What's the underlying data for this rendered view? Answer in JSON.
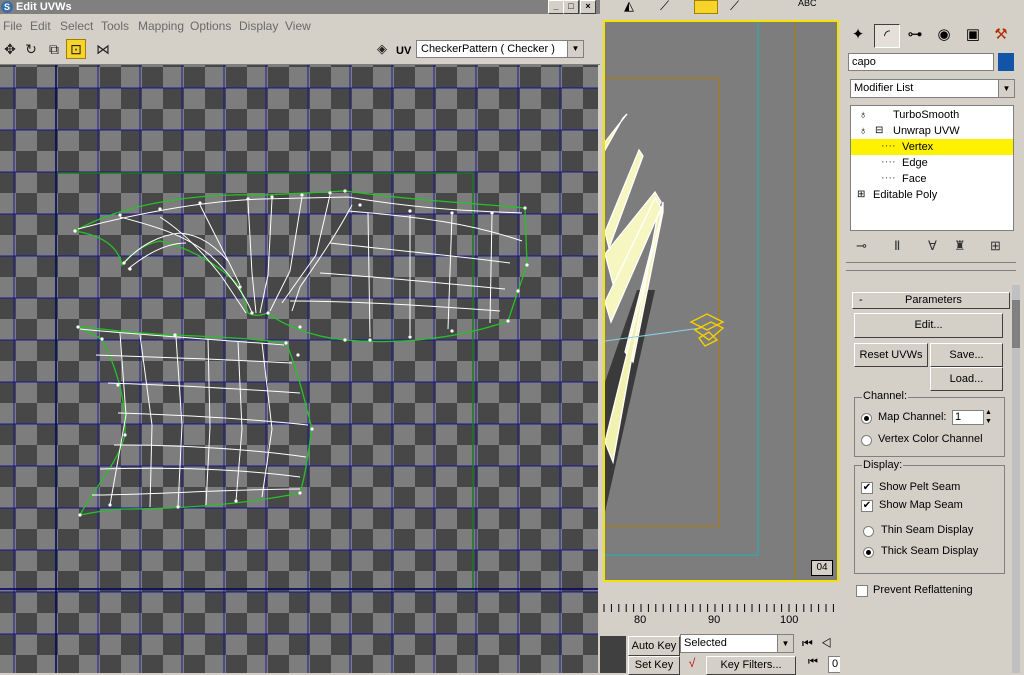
{
  "uvw_window": {
    "title": "Edit UVWs",
    "menu": [
      "File",
      "Edit",
      "Select",
      "Tools",
      "Mapping",
      "Options",
      "Display",
      "View"
    ],
    "toolbar": {
      "tools": [
        "move-icon",
        "rotate-icon",
        "scale-icon",
        "freeform-icon",
        "mirror-icon"
      ],
      "active_tool": "freeform-icon",
      "uv_label": "UV",
      "texture_dropdown": "CheckerPattern  ( Checker )"
    }
  },
  "viewport": {
    "label": "04",
    "accent_color": "#f4e200",
    "timeline_ticks": [
      "80",
      "90",
      "100"
    ],
    "auto_key_label": "Auto Key",
    "set_key_label": "Set Key",
    "key_mode": "Selected",
    "key_filters_label": "Key Filters...",
    "current_frame": "0"
  },
  "command_panel": {
    "tabs": [
      "create-icon",
      "modify-icon",
      "hierarchy-icon",
      "motion-icon",
      "display-icon",
      "utilities-icon"
    ],
    "active_tab": "modify-icon",
    "object_name": "capo",
    "object_color": "#1254a8",
    "modifier_list": "Modifier List",
    "stack": [
      {
        "label": "TurboSmooth",
        "level": 0
      },
      {
        "label": "Unwrap UVW",
        "level": 0,
        "expanded": true
      },
      {
        "label": "Vertex",
        "level": 1,
        "selected": true
      },
      {
        "label": "Edge",
        "level": 1
      },
      {
        "label": "Face",
        "level": 1
      },
      {
        "label": "Editable Poly",
        "level": 0
      }
    ],
    "parameters": {
      "header": "Parameters",
      "collapse_glyph": "-",
      "edit_button": "Edit...",
      "reset_uvws_button": "Reset UVWs",
      "save_button": "Save...",
      "load_button": "Load...",
      "channel_group": "Channel:",
      "map_channel_label": "Map Channel:",
      "map_channel_value": "1",
      "vertex_color_channel_label": "Vertex Color Channel",
      "channel_mode": "map",
      "display_group": "Display:",
      "show_pelt_seam_label": "Show Pelt Seam",
      "show_pelt_seam": true,
      "show_map_seam_label": "Show Map Seam",
      "show_map_seam": true,
      "thin_seam_label": "Thin Seam Display",
      "thick_seam_label": "Thick Seam Display",
      "seam_display": "thick",
      "prevent_reflattening_label": "Prevent Reflattening",
      "prevent_reflattening": false
    }
  }
}
